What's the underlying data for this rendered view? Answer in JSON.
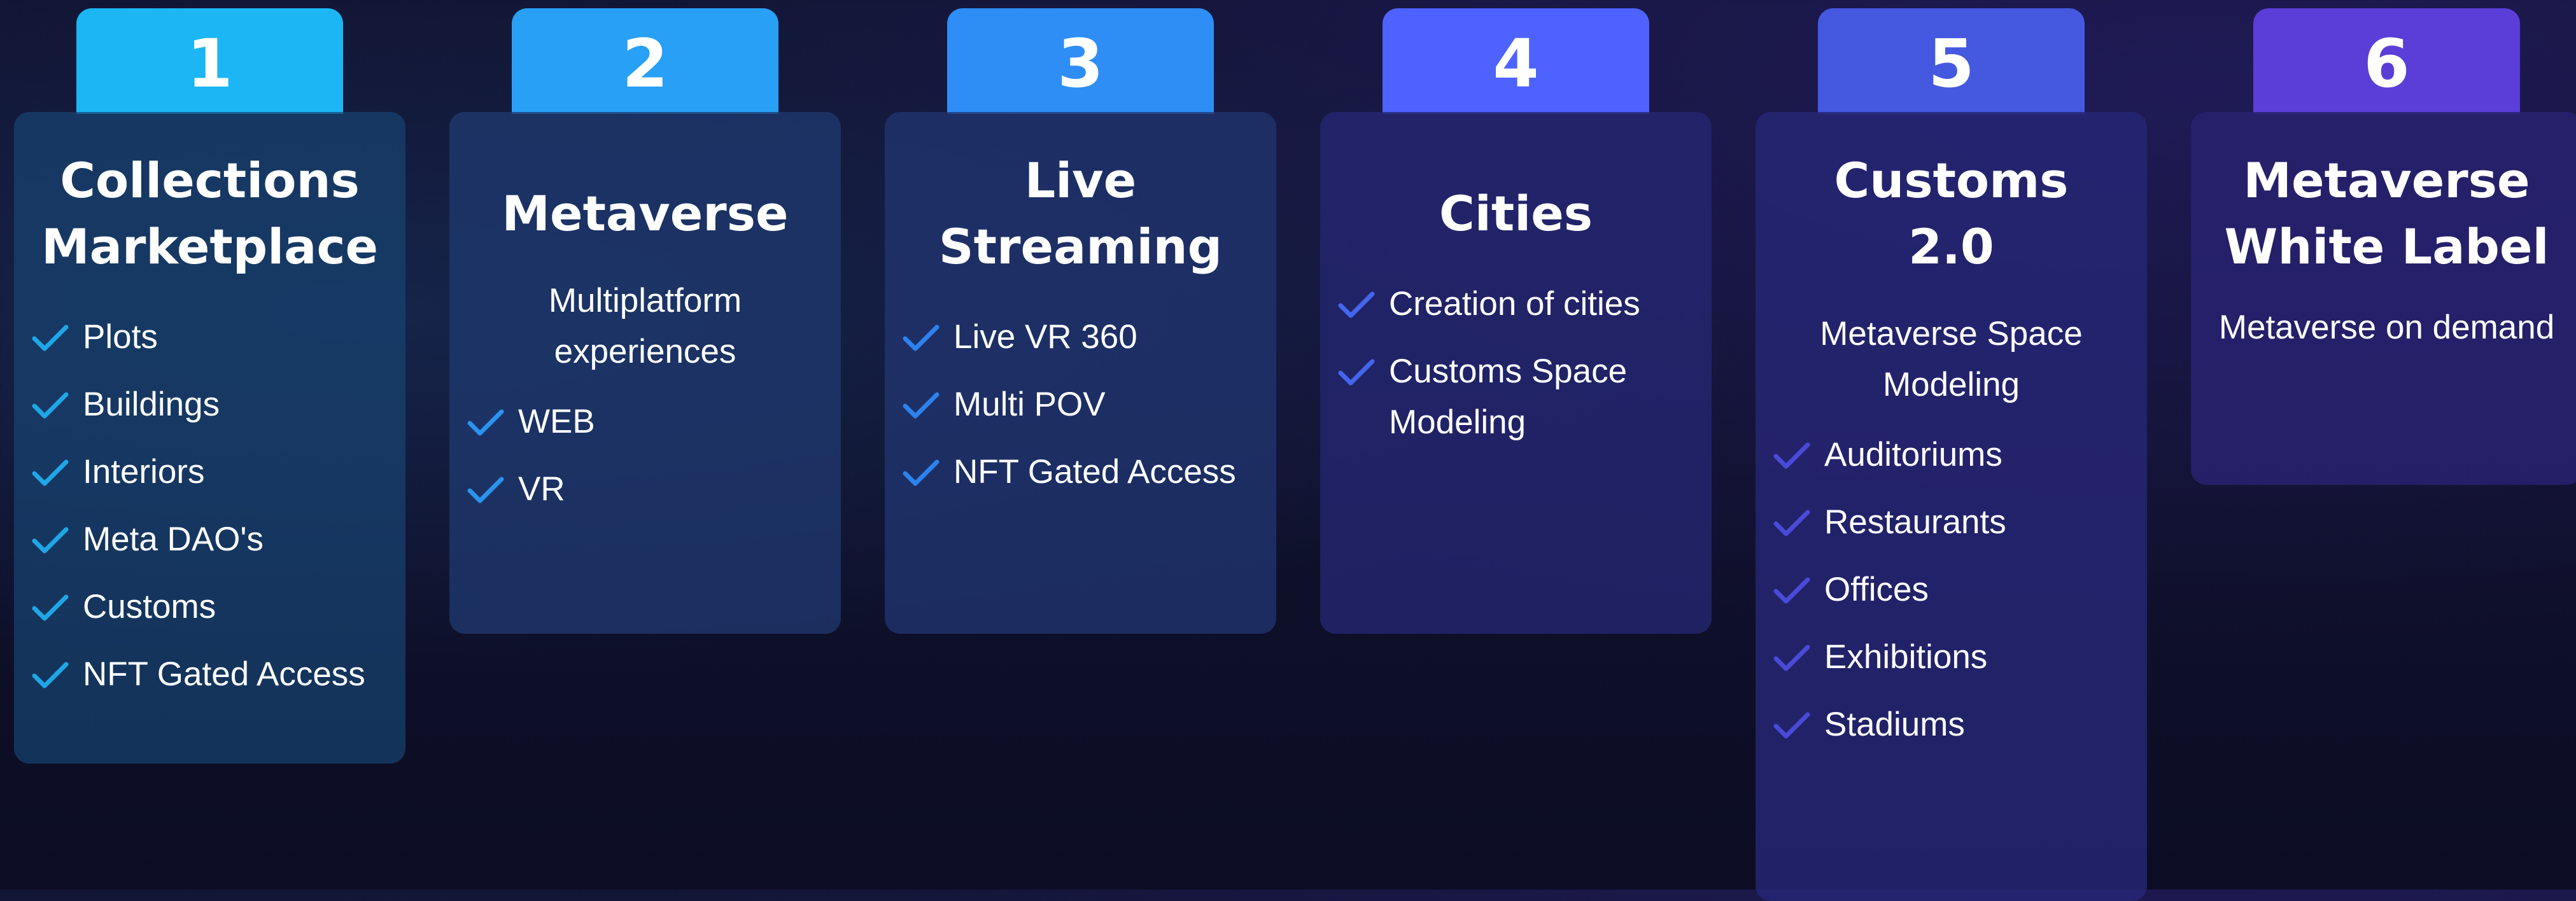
{
  "accent_colors": [
    "#1bb6f3",
    "#27a0f5",
    "#2e8ef5",
    "#4e62ff",
    "#4558e0",
    "#5b3ed7"
  ],
  "check_icon": "check-icon",
  "steps": [
    {
      "number": "1",
      "title_lines": [
        "Collections",
        "Marketplace"
      ],
      "subtitle_lines": [],
      "items": [
        "Plots",
        "Buildings",
        "Interiors",
        "Meta DAO's",
        "Customs",
        "NFT Gated Access"
      ]
    },
    {
      "number": "2",
      "title_lines": [
        "Metaverse"
      ],
      "subtitle_lines": [
        "Multiplatform",
        "experiences"
      ],
      "items": [
        "WEB",
        "VR"
      ]
    },
    {
      "number": "3",
      "title_lines": [
        "Live",
        "Streaming"
      ],
      "subtitle_lines": [],
      "items": [
        "Live VR 360",
        "Multi POV",
        "NFT Gated Access"
      ]
    },
    {
      "number": "4",
      "title_lines": [
        "Cities"
      ],
      "subtitle_lines": [],
      "items": [
        "Creation of cities",
        "Customs Space Modeling"
      ]
    },
    {
      "number": "5",
      "title_lines": [
        "Customs",
        "2.0"
      ],
      "subtitle_lines": [
        "Metaverse Space",
        "Modeling"
      ],
      "items": [
        "Auditoriums",
        "Restaurants",
        "Offices",
        "Exhibitions",
        "Stadiums"
      ]
    },
    {
      "number": "6",
      "title_lines": [
        "Metaverse",
        "White Label"
      ],
      "subtitle_lines": [
        "Metaverse on demand"
      ],
      "items": []
    }
  ]
}
